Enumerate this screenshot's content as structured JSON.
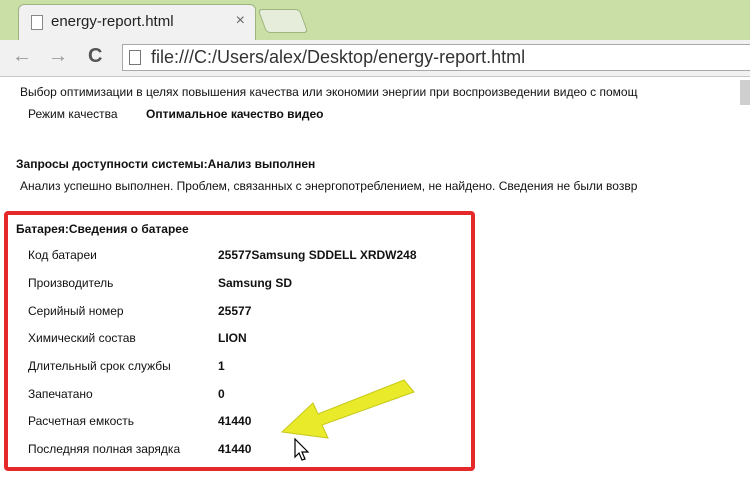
{
  "browser": {
    "tab_title": "energy-report.html",
    "tab_close": "×",
    "back": "←",
    "forward": "→",
    "reload": "C",
    "url": "file:///C:/Users/alex/Desktop/energy-report.html"
  },
  "report": {
    "video_note": "Выбор оптимизации в целях повышения качества или экономии энергии при воспроизведении видео с помощ",
    "quality_label": "Режим качества",
    "quality_value": "Оптимальное качество видео",
    "availability_heading": "Запросы доступности системы:Анализ выполнен",
    "availability_text": "Анализ успешно выполнен. Проблем, связанных с энергопотреблением, не найдено. Сведения не были возвр",
    "battery_heading": "Батарея:Сведения о батарее",
    "battery_rows": [
      {
        "label": "Код батареи",
        "value": "25577Samsung SDDELL XRDW248"
      },
      {
        "label": "Производитель",
        "value": "Samsung SD"
      },
      {
        "label": "Серийный номер",
        "value": "25577"
      },
      {
        "label": "Химический состав",
        "value": "LION"
      },
      {
        "label": "Длительный срок службы",
        "value": "1"
      },
      {
        "label": "Запечатано",
        "value": "0"
      },
      {
        "label": "Расчетная емкость",
        "value": "41440"
      },
      {
        "label": "Последняя полная зарядка",
        "value": "41440"
      }
    ]
  },
  "colors": {
    "highlight_box": "#e5292b",
    "arrow": "#e8ea2a"
  }
}
